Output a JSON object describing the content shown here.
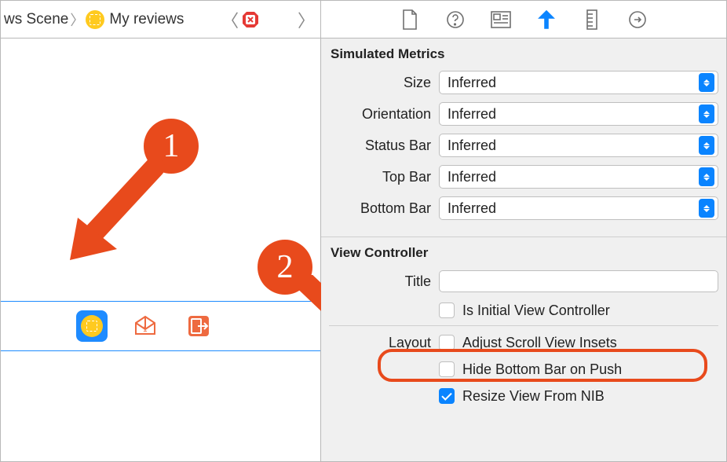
{
  "pathbar": {
    "crumb1": "ws Scene",
    "crumb2": "My reviews"
  },
  "inspector_tabs": [
    "file",
    "help",
    "identity",
    "attributes",
    "size",
    "connections"
  ],
  "simulated_metrics": {
    "title": "Simulated Metrics",
    "rows": [
      {
        "label": "Size",
        "value": "Inferred"
      },
      {
        "label": "Orientation",
        "value": "Inferred"
      },
      {
        "label": "Status Bar",
        "value": "Inferred"
      },
      {
        "label": "Top Bar",
        "value": "Inferred"
      },
      {
        "label": "Bottom Bar",
        "value": "Inferred"
      }
    ]
  },
  "view_controller": {
    "title": "View Controller",
    "title_label": "Title",
    "title_value": "",
    "checks": {
      "is_initial": {
        "label": "Is Initial View Controller",
        "checked": false
      },
      "layout_label": "Layout",
      "adjust_insets": {
        "label": "Adjust Scroll View Insets",
        "checked": false
      },
      "hide_bottom": {
        "label": "Hide Bottom Bar on Push",
        "checked": false
      },
      "resize_nib": {
        "label": "Resize View From NIB",
        "checked": true
      }
    }
  },
  "annotations": {
    "step1": "1",
    "step2": "2"
  }
}
